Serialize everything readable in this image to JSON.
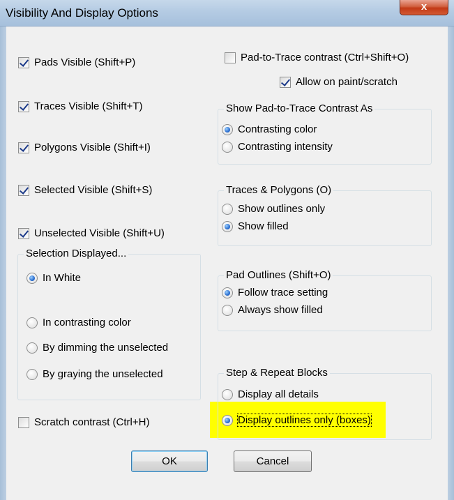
{
  "window": {
    "title": "Visibility And Display Options",
    "close_glyph": "x"
  },
  "left": {
    "pads": "Pads Visible (Shift+P)",
    "traces": "Traces Visible (Shift+T)",
    "polygons": "Polygons Visible (Shift+I)",
    "selected": "Selected Visible (Shift+S)",
    "unselected": "Unselected Visible (Shift+U)",
    "pads_checked": true,
    "traces_checked": true,
    "polygons_checked": true,
    "selected_checked": true,
    "unselected_checked": true
  },
  "selection_group": {
    "label": "Selection Displayed...",
    "options": [
      "In White",
      "In contrasting color",
      "By dimming the unselected",
      "By graying the unselected"
    ],
    "selected": "In White"
  },
  "scratch": {
    "label": "Scratch contrast (Ctrl+H)",
    "checked": false
  },
  "pad_trace": {
    "label": "Pad-to-Trace contrast  (Ctrl+Shift+O)",
    "checked": false
  },
  "allow_paint": {
    "label": "Allow on paint/scratch",
    "checked": true
  },
  "contrast_group": {
    "label": "Show Pad-to-Trace Contrast As",
    "options": [
      "Contrasting color",
      "Contrasting intensity"
    ],
    "selected": "Contrasting color"
  },
  "traces_group": {
    "label": "Traces & Polygons (O)",
    "options": [
      "Show outlines only",
      "Show filled"
    ],
    "selected": "Show filled"
  },
  "pad_outlines_group": {
    "label": "Pad Outlines (Shift+O)",
    "options": [
      "Follow trace setting",
      "Always show filled"
    ],
    "selected": "Follow trace setting"
  },
  "step_group": {
    "label": "Step & Repeat Blocks",
    "options": [
      "Display all details",
      "Display outlines only (boxes)"
    ],
    "selected": "Display outlines only (boxes)"
  },
  "buttons": {
    "ok": "OK",
    "cancel": "Cancel"
  },
  "colors": {
    "highlight": "#ffff00",
    "title_bar": "#b4cbe3",
    "close_button": "#c23a16"
  },
  "icons": {
    "checkbox": "checkbox-icon",
    "radio": "radio-icon",
    "close": "close-icon"
  }
}
